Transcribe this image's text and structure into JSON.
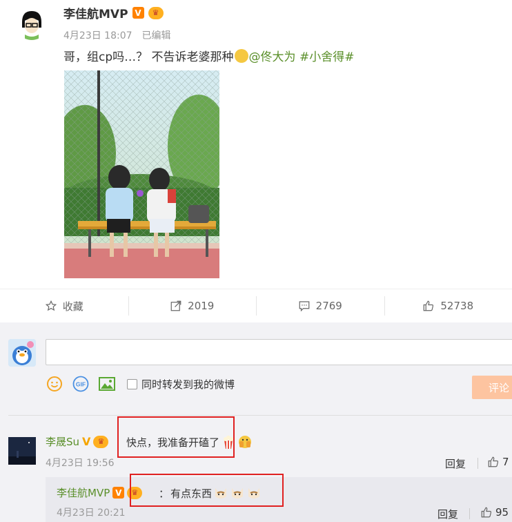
{
  "post": {
    "author": "李佳航MVP",
    "v_badge": "V",
    "date": "4月23日 18:07",
    "edited": "已编辑",
    "text_start": "哥，组cp吗…？ 不告诉老婆那种",
    "mention": "@佟大为",
    "hashtag": "#小舍得#"
  },
  "actions": [
    {
      "icon": "star-icon",
      "label": "收藏"
    },
    {
      "icon": "share-icon",
      "label": "2019"
    },
    {
      "icon": "comment-icon",
      "label": "2769"
    },
    {
      "icon": "thumbs-up-icon",
      "label": "52738"
    }
  ],
  "composer": {
    "placeholder": "",
    "repost_label": "同时转发到我的微博",
    "submit_label": "评论",
    "gif_label": "GIF"
  },
  "comments": [
    {
      "name": "李晟Su",
      "badge": "V",
      "text": "快点，我准备开磕了",
      "time": "4月23日 19:56",
      "reply_label": "回复",
      "likes": "7"
    }
  ],
  "reply": {
    "name": "李佳航MVP",
    "badge": "V",
    "colon": "：",
    "text": "有点东西",
    "time": "4月23日 20:21",
    "reply_label": "回复",
    "likes": "95"
  },
  "colors": {
    "accent_orange": "#ff8200",
    "link_green": "#5a8f2a",
    "highlight_red": "#e02020"
  }
}
